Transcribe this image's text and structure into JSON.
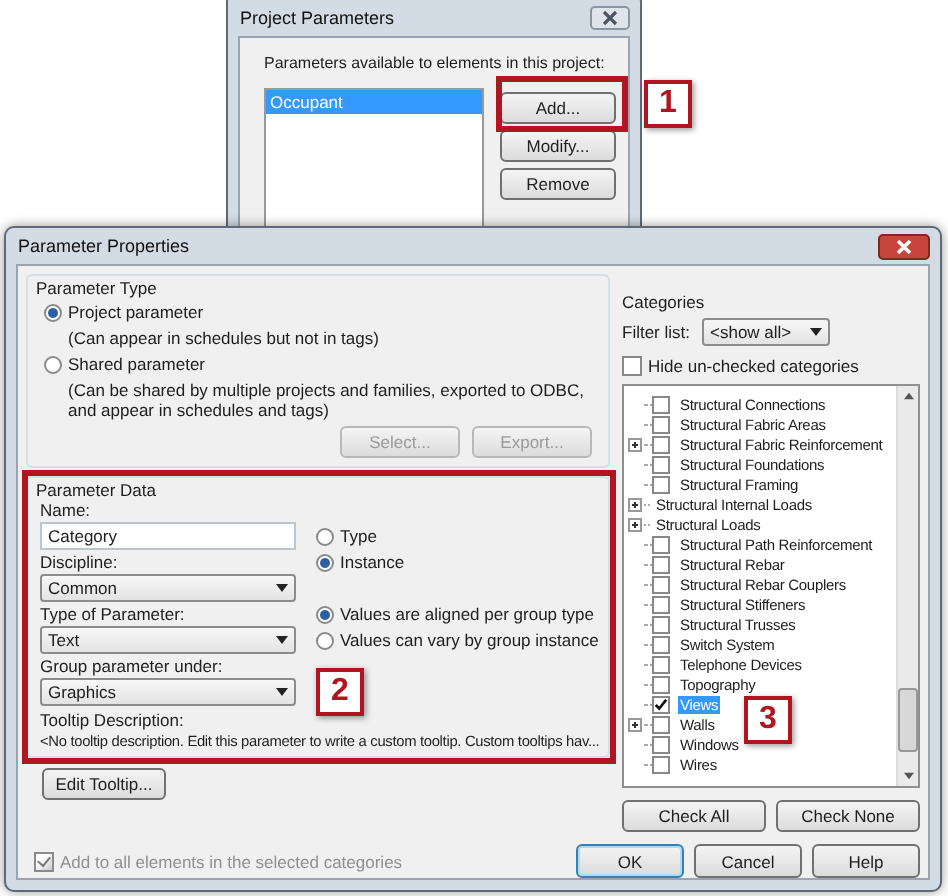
{
  "project_parameters": {
    "title": "Project Parameters",
    "label": "Parameters available to elements in this project:",
    "parameters": [
      {
        "name": "Occupant",
        "selected": true
      }
    ],
    "buttons": [
      "Add...",
      "Modify...",
      "Remove"
    ],
    "callout": "1"
  },
  "parameter_properties": {
    "title": "Parameter Properties",
    "parameter_type": {
      "legend": "Parameter Type",
      "options": [
        {
          "label": "Project parameter",
          "note": "(Can appear in schedules but not in tags)",
          "selected": true
        },
        {
          "label": "Shared parameter",
          "note": "(Can be shared by multiple projects and families, exported to ODBC, and appear in schedules and tags)",
          "selected": false
        }
      ],
      "buttons": [
        {
          "label": "Select...",
          "disabled": true
        },
        {
          "label": "Export...",
          "disabled": true
        }
      ]
    },
    "parameter_data": {
      "legend": "Parameter Data",
      "callout": "2",
      "name": {
        "label": "Name:",
        "value": "Category"
      },
      "discipline": {
        "label": "Discipline:",
        "value": "Common"
      },
      "type_of_parameter": {
        "label": "Type of Parameter:",
        "value": "Text"
      },
      "group_under": {
        "label": "Group parameter under:",
        "value": "Graphics"
      },
      "scope_options": [
        {
          "label": "Type",
          "selected": false
        },
        {
          "label": "Instance",
          "selected": true
        }
      ],
      "group_options": [
        {
          "label": "Values are aligned per group type",
          "selected": true
        },
        {
          "label": "Values can vary by group instance",
          "selected": false
        }
      ],
      "tooltip_label": "Tooltip Description:",
      "tooltip_text": "<No tooltip description. Edit this parameter to write a custom tooltip. Custom tooltips hav..."
    },
    "edit_tooltip_button": "Edit Tooltip...",
    "add_to_all": {
      "label": "Add to all elements in the selected categories",
      "checked": true,
      "disabled": true
    },
    "categories": {
      "legend": "Categories",
      "filter_label": "Filter list:",
      "filter_value": "<show all>",
      "hide_unchecked": {
        "label": "Hide un-checked categories",
        "checked": false
      },
      "callout": "3",
      "items": [
        {
          "label": "Structural Connections",
          "kind": "check",
          "checked": false,
          "selected": false
        },
        {
          "label": "Structural Fabric Areas",
          "kind": "check",
          "checked": false,
          "selected": false
        },
        {
          "label": "Structural Fabric Reinforcement",
          "kind": "check",
          "checked": false,
          "selected": false,
          "expanded": false
        },
        {
          "label": "Structural Foundations",
          "kind": "check",
          "checked": false,
          "selected": false
        },
        {
          "label": "Structural Framing",
          "kind": "check",
          "checked": false,
          "selected": false
        },
        {
          "label": "Structural Internal Loads",
          "kind": "group",
          "expanded": false
        },
        {
          "label": "Structural Loads",
          "kind": "group",
          "expanded": false
        },
        {
          "label": "Structural Path Reinforcement",
          "kind": "check",
          "checked": false,
          "selected": false
        },
        {
          "label": "Structural Rebar",
          "kind": "check",
          "checked": false,
          "selected": false
        },
        {
          "label": "Structural Rebar Couplers",
          "kind": "check",
          "checked": false,
          "selected": false
        },
        {
          "label": "Structural Stiffeners",
          "kind": "check",
          "checked": false,
          "selected": false
        },
        {
          "label": "Structural Trusses",
          "kind": "check",
          "checked": false,
          "selected": false
        },
        {
          "label": "Switch System",
          "kind": "check",
          "checked": false,
          "selected": false
        },
        {
          "label": "Telephone Devices",
          "kind": "check",
          "checked": false,
          "selected": false
        },
        {
          "label": "Topography",
          "kind": "check",
          "checked": false,
          "selected": false
        },
        {
          "label": "Views",
          "kind": "check",
          "checked": true,
          "selected": true
        },
        {
          "label": "Walls",
          "kind": "check",
          "checked": false,
          "selected": false,
          "expanded": false
        },
        {
          "label": "Windows",
          "kind": "check",
          "checked": false,
          "selected": false
        },
        {
          "label": "Wires",
          "kind": "check",
          "checked": false,
          "selected": false
        }
      ],
      "buttons": [
        "Check All",
        "Check None"
      ]
    },
    "buttons": [
      {
        "label": "OK",
        "default": true
      },
      {
        "label": "Cancel",
        "default": false
      },
      {
        "label": "Help",
        "default": false
      }
    ]
  }
}
